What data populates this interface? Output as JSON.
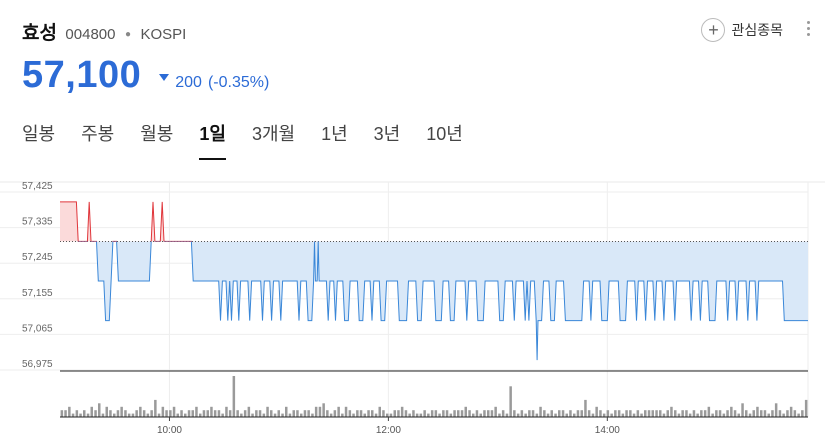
{
  "header": {
    "name": "효성",
    "code": "004800",
    "market": "KOSPI",
    "watch_label": "관심종목"
  },
  "price": {
    "current": "57,100",
    "change": "200",
    "change_pct": "(-0.35%)",
    "direction": "down"
  },
  "tabs": [
    {
      "label": "일봉",
      "active": false
    },
    {
      "label": "주봉",
      "active": false
    },
    {
      "label": "월봉",
      "active": false
    },
    {
      "label": "1일",
      "active": true
    },
    {
      "label": "3개월",
      "active": false
    },
    {
      "label": "1년",
      "active": false
    },
    {
      "label": "3년",
      "active": false
    },
    {
      "label": "10년",
      "active": false
    }
  ],
  "colors": {
    "accent": "#2c6bd6",
    "up_line": "#e0363b",
    "up_fill": "#fbdada",
    "down_line": "#3a87d8",
    "down_fill": "#d9e8f8",
    "volume": "#9a9a9a"
  },
  "chart_data": {
    "type": "line",
    "baseline": 57300,
    "ylim": [
      56975,
      57425
    ],
    "y_ticks": [
      "57,425",
      "57,335",
      "57,245",
      "57,155",
      "57,065",
      "56,975"
    ],
    "y_tick_values": [
      57425,
      57335,
      57245,
      57155,
      57065,
      56975
    ],
    "x_ticks": [
      {
        "label": "10:00",
        "t": 60
      },
      {
        "label": "12:00",
        "t": 180
      },
      {
        "label": "14:00",
        "t": 300
      }
    ],
    "x_range": [
      0,
      410
    ],
    "series": [
      {
        "points": [
          [
            0,
            57400
          ],
          [
            9,
            57400
          ],
          [
            10,
            57300
          ],
          [
            15,
            57300
          ],
          [
            16,
            57400
          ],
          [
            17,
            57300
          ],
          [
            20,
            57300
          ],
          [
            21,
            57200
          ],
          [
            24,
            57200
          ],
          [
            25,
            57100
          ],
          [
            27,
            57100
          ],
          [
            28,
            57200
          ],
          [
            29,
            57300
          ],
          [
            31,
            57300
          ],
          [
            32,
            57200
          ],
          [
            49,
            57200
          ],
          [
            50,
            57300
          ],
          [
            51,
            57400
          ],
          [
            52,
            57300
          ],
          [
            55,
            57300
          ],
          [
            56,
            57400
          ],
          [
            57,
            57300
          ],
          [
            72,
            57300
          ],
          [
            73,
            57200
          ],
          [
            87,
            57200
          ],
          [
            88,
            57100
          ],
          [
            89,
            57200
          ],
          [
            91,
            57200
          ],
          [
            92,
            57100
          ],
          [
            93,
            57200
          ],
          [
            94,
            57100
          ],
          [
            95,
            57200
          ],
          [
            97,
            57200
          ],
          [
            98,
            57100
          ],
          [
            99,
            57200
          ],
          [
            103,
            57200
          ],
          [
            104,
            57100
          ],
          [
            105,
            57200
          ],
          [
            110,
            57200
          ],
          [
            111,
            57100
          ],
          [
            112,
            57200
          ],
          [
            115,
            57200
          ],
          [
            116,
            57100
          ],
          [
            117,
            57200
          ],
          [
            120,
            57200
          ],
          [
            121,
            57100
          ],
          [
            122,
            57200
          ],
          [
            130,
            57200
          ],
          [
            131,
            57100
          ],
          [
            132,
            57200
          ],
          [
            135,
            57200
          ],
          [
            136,
            57100
          ],
          [
            138,
            57100
          ],
          [
            139,
            57200
          ],
          [
            139.5,
            57300
          ],
          [
            140,
            57200
          ],
          [
            141,
            57200
          ],
          [
            141.5,
            57300
          ],
          [
            142,
            57200
          ],
          [
            146,
            57200
          ],
          [
            147,
            57100
          ],
          [
            148,
            57200
          ],
          [
            150,
            57200
          ],
          [
            151,
            57100
          ],
          [
            152,
            57200
          ],
          [
            155,
            57200
          ],
          [
            156,
            57100
          ],
          [
            158,
            57100
          ],
          [
            159,
            57200
          ],
          [
            163,
            57200
          ],
          [
            164,
            57100
          ],
          [
            166,
            57100
          ],
          [
            167,
            57200
          ],
          [
            170,
            57200
          ],
          [
            171,
            57100
          ],
          [
            172,
            57200
          ],
          [
            175,
            57200
          ],
          [
            176,
            57100
          ],
          [
            178,
            57100
          ],
          [
            179,
            57200
          ],
          [
            185,
            57200
          ],
          [
            186,
            57100
          ],
          [
            190,
            57100
          ],
          [
            191,
            57200
          ],
          [
            195,
            57200
          ],
          [
            196,
            57100
          ],
          [
            198,
            57100
          ],
          [
            199,
            57200
          ],
          [
            205,
            57200
          ],
          [
            206,
            57100
          ],
          [
            209,
            57100
          ],
          [
            210,
            57200
          ],
          [
            213,
            57200
          ],
          [
            214,
            57100
          ],
          [
            216,
            57100
          ],
          [
            217,
            57200
          ],
          [
            222,
            57200
          ],
          [
            223,
            57100
          ],
          [
            224,
            57200
          ],
          [
            228,
            57200
          ],
          [
            229,
            57100
          ],
          [
            232,
            57100
          ],
          [
            233,
            57200
          ],
          [
            240,
            57200
          ],
          [
            241,
            57100
          ],
          [
            243,
            57100
          ],
          [
            244,
            57200
          ],
          [
            248,
            57200
          ],
          [
            249,
            57100
          ],
          [
            250,
            57200
          ],
          [
            254,
            57200
          ],
          [
            255,
            57100
          ],
          [
            256,
            57200
          ],
          [
            257,
            57100
          ],
          [
            258,
            57200
          ],
          [
            260,
            57200
          ],
          [
            261,
            57100
          ],
          [
            261.5,
            57000
          ],
          [
            262,
            57100
          ],
          [
            264,
            57100
          ],
          [
            265,
            57200
          ],
          [
            268,
            57200
          ],
          [
            269,
            57100
          ],
          [
            271,
            57100
          ],
          [
            272,
            57200
          ],
          [
            276,
            57200
          ],
          [
            277,
            57100
          ],
          [
            286,
            57100
          ],
          [
            287,
            57200
          ],
          [
            290,
            57200
          ],
          [
            291,
            57100
          ],
          [
            292,
            57200
          ],
          [
            296,
            57200
          ],
          [
            297,
            57100
          ],
          [
            300,
            57100
          ],
          [
            301,
            57200
          ],
          [
            306,
            57200
          ],
          [
            307,
            57100
          ],
          [
            310,
            57100
          ],
          [
            311,
            57200
          ],
          [
            315,
            57200
          ],
          [
            316,
            57100
          ],
          [
            317,
            57200
          ],
          [
            320,
            57200
          ],
          [
            321,
            57100
          ],
          [
            322,
            57200
          ],
          [
            325,
            57200
          ],
          [
            326,
            57100
          ],
          [
            327,
            57200
          ],
          [
            330,
            57200
          ],
          [
            331,
            57100
          ],
          [
            332,
            57200
          ],
          [
            336,
            57200
          ],
          [
            337,
            57100
          ],
          [
            338,
            57200
          ],
          [
            345,
            57200
          ],
          [
            346,
            57100
          ],
          [
            347,
            57200
          ],
          [
            350,
            57200
          ],
          [
            351,
            57100
          ],
          [
            352,
            57200
          ],
          [
            355,
            57200
          ],
          [
            356,
            57100
          ],
          [
            359,
            57100
          ],
          [
            360,
            57200
          ],
          [
            365,
            57200
          ],
          [
            366,
            57100
          ],
          [
            367,
            57200
          ],
          [
            370,
            57200
          ],
          [
            371,
            57100
          ],
          [
            372,
            57200
          ],
          [
            376,
            57200
          ],
          [
            377,
            57100
          ],
          [
            378,
            57200
          ],
          [
            381,
            57200
          ],
          [
            382,
            57100
          ],
          [
            383,
            57200
          ],
          [
            396,
            57200
          ],
          [
            397,
            57100
          ],
          [
            410,
            57100
          ]
        ]
      }
    ],
    "volume": [
      2,
      2,
      3,
      1,
      2,
      1,
      2,
      1,
      3,
      2,
      4,
      1,
      3,
      2,
      1,
      2,
      3,
      2,
      1,
      1,
      2,
      3,
      2,
      1,
      2,
      5,
      1,
      3,
      2,
      2,
      3,
      1,
      2,
      1,
      2,
      2,
      3,
      1,
      2,
      2,
      3,
      2,
      2,
      1,
      3,
      2,
      12,
      2,
      1,
      2,
      3,
      1,
      2,
      2,
      1,
      3,
      2,
      1,
      2,
      1,
      3,
      1,
      2,
      2,
      1,
      2,
      2,
      1,
      3,
      3,
      4,
      2,
      1,
      2,
      3,
      1,
      3,
      2,
      1,
      2,
      2,
      1,
      2,
      2,
      1,
      3,
      2,
      1,
      1,
      2,
      2,
      3,
      2,
      1,
      2,
      1,
      1,
      2,
      1,
      2,
      2,
      1,
      2,
      2,
      1,
      2,
      2,
      2,
      3,
      2,
      1,
      2,
      1,
      2,
      2,
      2,
      3,
      1,
      2,
      1,
      9,
      2,
      1,
      2,
      1,
      2,
      2,
      1,
      3,
      2,
      1,
      2,
      1,
      2,
      2,
      1,
      2,
      1,
      2,
      2,
      5,
      2,
      1,
      3,
      2,
      1,
      2,
      1,
      2,
      2,
      1,
      2,
      2,
      1,
      2,
      1,
      2,
      2,
      2,
      2,
      2,
      1,
      2,
      3,
      2,
      1,
      2,
      2,
      1,
      2,
      1,
      2,
      2,
      3,
      1,
      2,
      2,
      1,
      2,
      3,
      2,
      1,
      4,
      2,
      1,
      2,
      3,
      2,
      2,
      1,
      2,
      4,
      2,
      1,
      2,
      3,
      2,
      1,
      2,
      5
    ]
  }
}
